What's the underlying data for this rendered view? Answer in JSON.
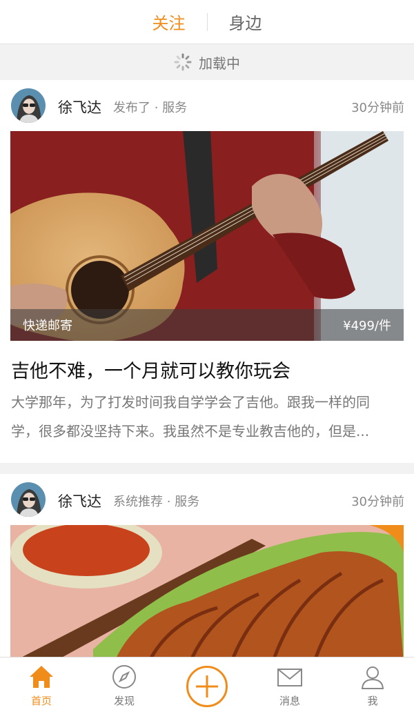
{
  "tabs": [
    {
      "label": "关注",
      "active": true
    },
    {
      "label": "身边",
      "active": false
    }
  ],
  "loading_text": "加载中",
  "posts": [
    {
      "author": "徐飞达",
      "meta": "发布了 · 服务",
      "time": "30分钟前",
      "shipping": "快递邮寄",
      "price": "¥499/件",
      "title": "吉他不难，一个月就可以教你玩会",
      "body_line1": "大学那年，为了打发时间我自学学会了吉他。跟我一样的同",
      "body_line2": "学，很多都没坚持下来。我虽然不是专业教吉他的，但是..."
    },
    {
      "author": "徐飞达",
      "meta": "系统推荐 · 服务",
      "time": "30分钟前"
    }
  ],
  "nav": {
    "home": "首页",
    "discover": "发现",
    "messages": "消息",
    "me": "我"
  },
  "colors": {
    "accent": "#f08c1a",
    "background": "#f2f2f2"
  }
}
